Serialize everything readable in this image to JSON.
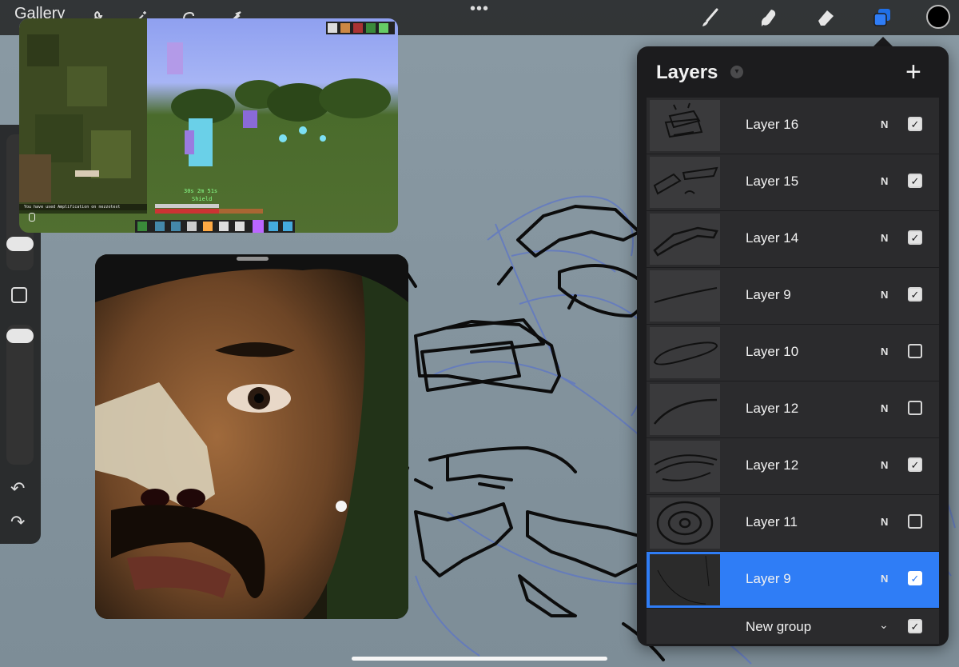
{
  "app": {
    "gallery_label": "Gallery",
    "more_dots": "•••"
  },
  "toolbar": {
    "left_tools": [
      "wrench-icon",
      "magic-wand-icon",
      "selection-icon",
      "transform-arrow-icon"
    ],
    "right_tools": [
      "brush-icon",
      "smudge-icon",
      "eraser-icon",
      "layers-icon"
    ],
    "active_tool": "layers-icon",
    "color": "#000000"
  },
  "sidebar": {
    "undo": "↶",
    "redo": "↷"
  },
  "game_pip": {
    "chat_text": "You have used Amplification on nezzotest",
    "timer_text": "30s  2m 51s",
    "action_text": "Shield"
  },
  "layers_panel": {
    "title": "Layers",
    "add_label": "+",
    "layers": [
      {
        "name": "Layer 16",
        "blend": "N",
        "visible": true,
        "active": false
      },
      {
        "name": "Layer 15",
        "blend": "N",
        "visible": true,
        "active": false
      },
      {
        "name": "Layer 14",
        "blend": "N",
        "visible": true,
        "active": false
      },
      {
        "name": "Layer 9",
        "blend": "N",
        "visible": true,
        "active": false
      },
      {
        "name": "Layer 10",
        "blend": "N",
        "visible": false,
        "active": false
      },
      {
        "name": "Layer 12",
        "blend": "N",
        "visible": false,
        "active": false
      },
      {
        "name": "Layer 12",
        "blend": "N",
        "visible": true,
        "active": false
      },
      {
        "name": "Layer 11",
        "blend": "N",
        "visible": false,
        "active": false
      },
      {
        "name": "Layer 9",
        "blend": "N",
        "visible": true,
        "active": true
      }
    ],
    "group": {
      "name": "New group",
      "visible": true
    }
  },
  "colors": {
    "accent": "#2f7df6",
    "panel_bg": "#1c1c1e",
    "canvas_bg": "#85959f",
    "sketch": "#5b74c9"
  }
}
